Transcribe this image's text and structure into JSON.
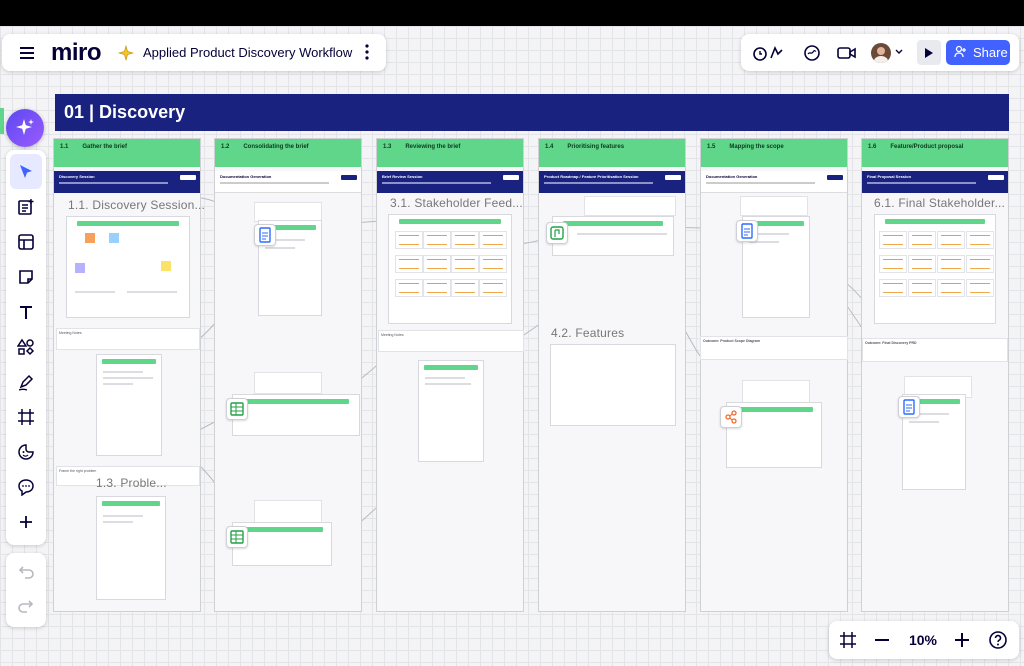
{
  "app": {
    "logo": "miro",
    "board_title": "Applied Product Discovery Workflow"
  },
  "header_right": {
    "share_label": "Share"
  },
  "zoom": {
    "level": "10%"
  },
  "board": {
    "banner": "01 | Discovery",
    "columns": [
      {
        "num": "1.1",
        "title": "Gather the brief",
        "nav": "Discovery Session"
      },
      {
        "num": "1.2",
        "title": "Consolidating the brief",
        "nav": "Documentation Generation"
      },
      {
        "num": "1.3",
        "title": "Reviewing the brief",
        "nav": "Brief Review Session"
      },
      {
        "num": "1.4",
        "title": "Prioritising features",
        "nav": "Product Roadmap / Feature Prioritisation Session"
      },
      {
        "num": "1.5",
        "title": "Mapping the scope",
        "nav": "Documentation Generation"
      },
      {
        "num": "1.6",
        "title": "Feature/Product proposal",
        "nav": "Final Proposal Session"
      }
    ],
    "frame_labels": {
      "f1": "1.1. Discovery Session...",
      "f2": "3.1. Stakeholder Feed...",
      "f3": "6.1. Final Stakeholder...",
      "f4": "4.2. Features",
      "f5": "1.3. Proble..."
    },
    "sheets": {
      "discovery_canvas": "Discovery Session Canvas",
      "product_brief": "Product Brief",
      "stakeholder_feedback": "Stakeholder Feedback",
      "roadmap": "Product Roadmap Board",
      "prd": "PRD 1.1",
      "final_feedback": "Final Stakeholder Feedback",
      "meeting_notes_1": "Meeting Notes",
      "meeting_notes_2": "Meeting Notes",
      "discovery_notes": "Discovery Session Notes",
      "brief_notes": "Brief Review Notes",
      "problem_statement": "Problem Statement",
      "frame_problem": "Frame the right problem",
      "outcome_scope": "Outcome: Product Scope Diagram",
      "outcome_prd": "Outcome: Final Discovery PRD",
      "scope_diagram": "Scope Diagram",
      "final_prd": "Final Discovery PRD",
      "feature_matrix": "Feature Matching",
      "assumption_log": "Assumption Log"
    }
  },
  "colors": {
    "brand_blue": "#4262ff",
    "banner_navy": "#1a2280",
    "header_green": "#5fd68a",
    "ai_purple": "#7b5cff"
  },
  "icons": [
    "menu-icon",
    "sparkle-icon",
    "more-icon",
    "timer-reactions-icon",
    "chat-icon",
    "video-icon",
    "avatar",
    "chevron-down-icon",
    "present-icon",
    "share-user-icon",
    "ai-sparkle-icon",
    "select-cursor-icon",
    "templates-icon",
    "frame-layout-icon",
    "sticky-note-icon",
    "text-icon",
    "shapes-icon",
    "pen-icon",
    "frame-icon",
    "emoji-icon",
    "comment-icon",
    "plus-icon",
    "undo-icon",
    "redo-icon",
    "fit-frame-icon",
    "zoom-out-icon",
    "zoom-in-icon",
    "help-icon"
  ]
}
